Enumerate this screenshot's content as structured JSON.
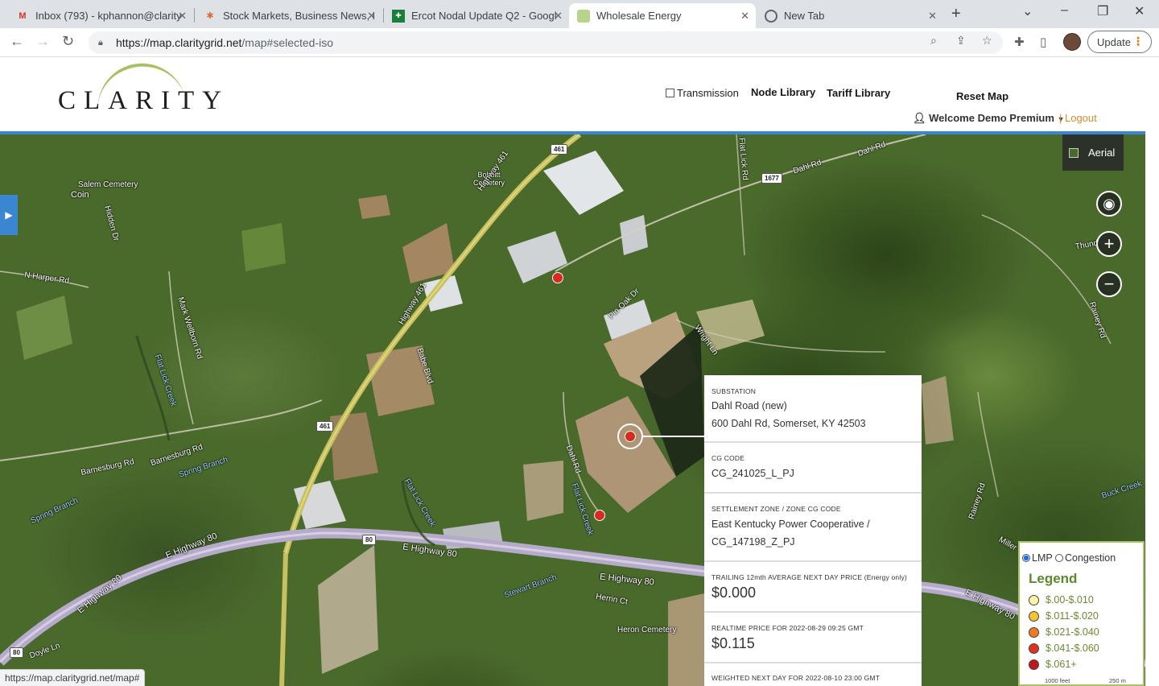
{
  "browser": {
    "tabs": [
      {
        "title": "Inbox (793) - kphannon@clarity",
        "icon": "gmail-icon",
        "active": false
      },
      {
        "title": "Stock Markets, Business News, F",
        "icon": "nbc-icon",
        "active": false
      },
      {
        "title": "Ercot Nodal Update Q2 - Googl",
        "icon": "sheets-icon",
        "active": false
      },
      {
        "title": "Wholesale Energy",
        "icon": "clarity-icon",
        "active": true
      },
      {
        "title": "New Tab",
        "icon": "chrome-icon",
        "active": false
      }
    ],
    "url_host": "https://map.claritygrid.net",
    "url_path": "/map#selected-iso",
    "update_label": "Update",
    "status_url": "https://map.claritygrid.net/map#"
  },
  "header": {
    "logo_text": "CLARITY",
    "transmission_label": "Transmission",
    "node_library": "Node Library",
    "tariff_library": "Tariff Library",
    "reset_map": "Reset Map",
    "welcome": "Welcome Demo Premium",
    "logout": "| Logout"
  },
  "map": {
    "basemap_label": "Aerial",
    "labels": {
      "salem": "Salem Cemetery",
      "coin": "Coin",
      "bobbitt": "Bobbitt\nCemetery",
      "n_harper": "N Harper Rd",
      "hidden": "Hidden Dr",
      "highway461": "Highway 461",
      "babe": "Babe Blvd",
      "mark_wellborn": "Mark Wellborn Rd",
      "flat_lick_creek": "Flat Lick Creek",
      "barnesburg": "Barnesburg Rd",
      "spring_branch": "Spring Branch",
      "spring_branch2": "Spring Branch",
      "dahl": "Dahl Rd",
      "dahl2": "Dahl Rd",
      "pin_oak": "Pin Oak Dr",
      "wright": "Wright Ln",
      "flat_lick_rd": "Flat Lick Rd",
      "e_highway80_a": "E Highway 80",
      "e_highway80_b": "E Highway 80",
      "e_highway80_c": "E Highway 80",
      "e_highway80_d": "E Highway 80",
      "e_highway80_e": "E Highway 80",
      "stewart": "Stewart Branch",
      "herrin": "Herrin Ct",
      "heron": "Heron Cemetery",
      "doyle": "Doyle Ln",
      "buck": "Buck Creek",
      "thund": "Thund",
      "rainey": "Rainey Rd",
      "miller": "Miller",
      "flat_lick_creek2": "Flat Lick Creek",
      "flat_lick_creek3": "Flat Lick Creek"
    },
    "shields": {
      "s461a": "461",
      "s461b": "461",
      "s1677": "1677",
      "s80a": "80",
      "s80b": "80"
    }
  },
  "info_panel": {
    "substation_heading": "SUBSTATION",
    "substation_name": "Dahl Road (new)",
    "substation_address": "600 Dahl Rd, Somerset, KY 42503",
    "cg_code_heading": "CG CODE",
    "cg_code": "CG_241025_L_PJ",
    "zone_heading": "SETTLEMENT ZONE / ZONE CG CODE",
    "zone_line1": "East Kentucky Power Cooperative /",
    "zone_line2": "CG_147198_Z_PJ",
    "trailing_heading": "TRAILING 12mth AVERAGE NEXT DAY PRICE (Energy only)",
    "trailing_value": "$0.000",
    "realtime_heading": "REALTIME PRICE FOR 2022-08-29 09:25 GMT",
    "realtime_value": "$0.115",
    "weighted_heading": "WEIGHTED NEXT DAY FOR 2022-08-10 23:00 GMT"
  },
  "legend": {
    "lmp_label": "LMP",
    "congestion_label": "Congestion",
    "selected": "LMP",
    "title": "Legend",
    "items": [
      {
        "label": "$.00-$.010",
        "color": "#fbf3a0"
      },
      {
        "label": "$.011-$.020",
        "color": "#f4c430"
      },
      {
        "label": "$.021-$.040",
        "color": "#f07a20"
      },
      {
        "label": "$.041-$.060",
        "color": "#e2311d"
      },
      {
        "label": "$.061+",
        "color": "#c0171a"
      }
    ],
    "scale_feet": "1000 feet",
    "scale_m": "250 m"
  }
}
